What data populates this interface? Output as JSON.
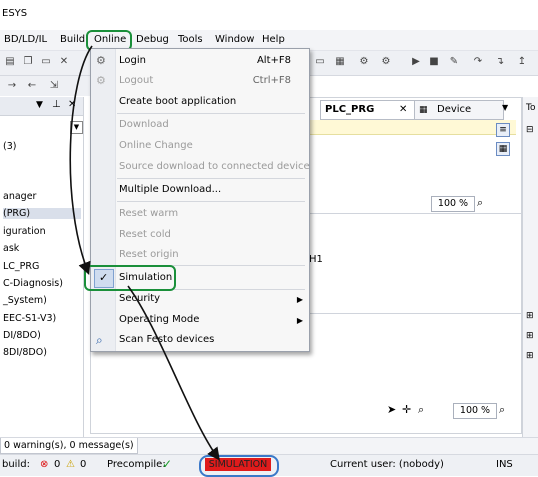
{
  "title": "ESYS",
  "menubar": [
    "BD/LD/IL",
    "Build",
    "Online",
    "Debug",
    "Tools",
    "Window",
    "Help"
  ],
  "online_menu": {
    "items": [
      {
        "label": "Login",
        "shortcut": "Alt+F8"
      },
      {
        "label": "Logout",
        "shortcut": "Ctrl+F8"
      },
      {
        "label": "Create boot application"
      },
      {
        "label": "Download"
      },
      {
        "label": "Online Change"
      },
      {
        "label": "Source download to connected device"
      },
      {
        "label": "Multiple Download..."
      },
      {
        "label": "Reset warm"
      },
      {
        "label": "Reset cold"
      },
      {
        "label": "Reset origin"
      },
      {
        "label": "Simulation",
        "checked": true
      },
      {
        "label": "Security"
      },
      {
        "label": "Operating Mode"
      },
      {
        "label": "Scan Festo devices"
      }
    ]
  },
  "left_tree": [
    "(3)",
    "anager",
    "(PRG)",
    "iguration",
    "ask",
    "LC_PRG",
    "C-Diagnosis)",
    "_System)",
    "EEC-S1-V3)",
    "DI/8DO)",
    "8DI/8DO)"
  ],
  "editor": {
    "tabs": [
      "PLC_PRG",
      "Device"
    ],
    "code_fragment": "H1",
    "zoom": "100 %",
    "zoom2": "100 %"
  },
  "right_label": "To",
  "messages": {
    "summary": "0 warning(s), 0 message(s)"
  },
  "status": {
    "build": "build:",
    "err_count": "0",
    "warn_count": "0",
    "precompile": "Precompile:",
    "mode": "SIMULATION",
    "user": "Current user: (nobody)",
    "ins": "INS"
  }
}
